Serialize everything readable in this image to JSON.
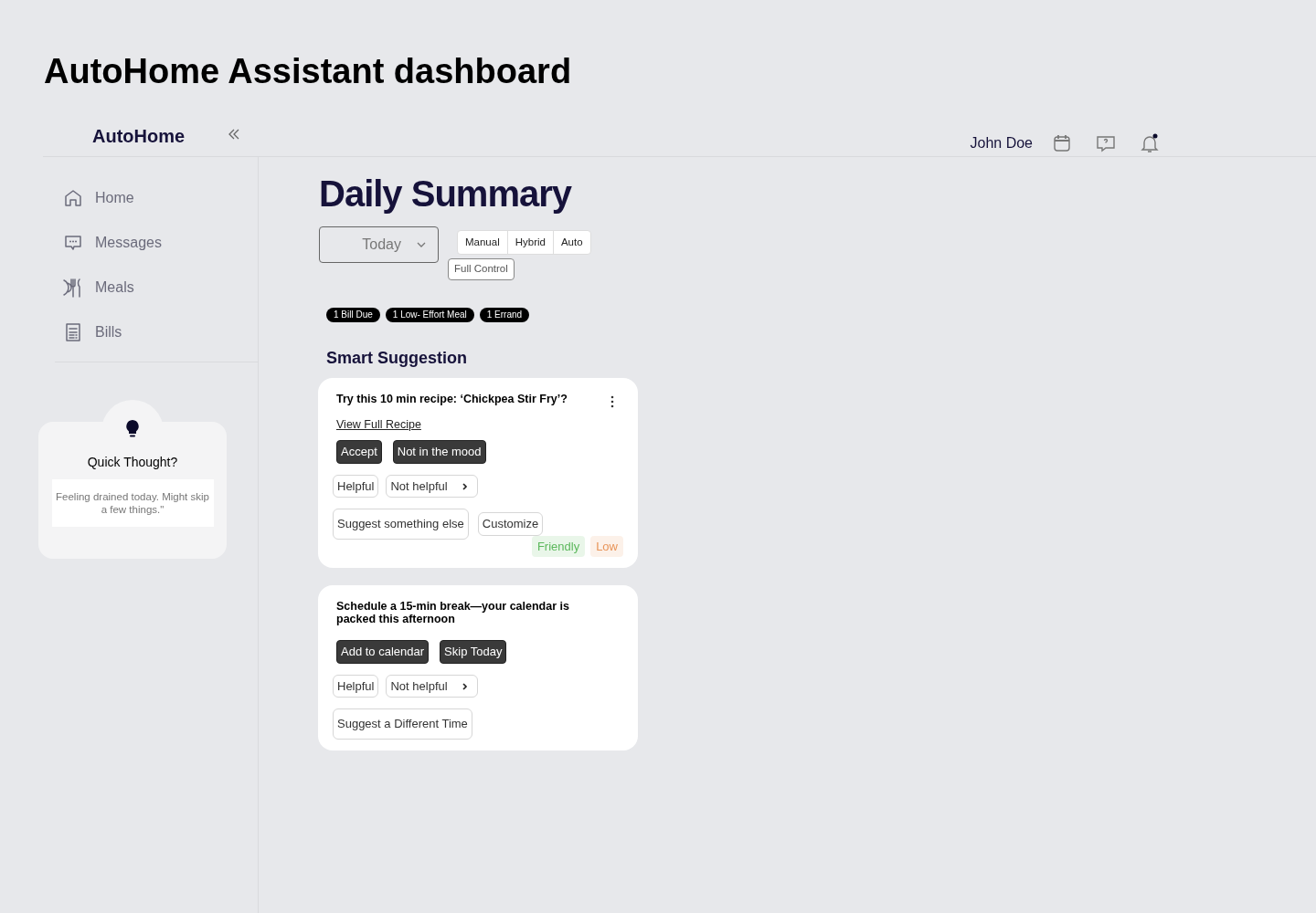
{
  "page_title": "AutoHome Assistant dashboard",
  "header": {
    "brand": "AutoHome",
    "user_name": "John Doe",
    "has_unread_notifications": true
  },
  "sidebar": {
    "items": [
      {
        "label": "Home",
        "kind": "home"
      },
      {
        "label": "Messages",
        "kind": "messages"
      },
      {
        "label": "Meals",
        "kind": "meals"
      },
      {
        "label": "Bills",
        "kind": "bills"
      }
    ],
    "quick_thought": {
      "title": "Quick Thought?",
      "text": "Feeling drained today. Might skip a few things.\""
    }
  },
  "main": {
    "title": "Daily Summary",
    "period_select": {
      "value": "Today"
    },
    "modes": [
      "Manual",
      "Hybrid",
      "Auto"
    ],
    "full_control": "Full Control",
    "chips": [
      "1 Bill Due",
      "1 Low- Effort Meal",
      "1 Errand"
    ],
    "section_title": "Smart Suggestion",
    "cards": [
      {
        "title": "Try this 10 min recipe: ‘Chickpea Stir Fry’?",
        "has_menu": true,
        "link": "View Full Recipe",
        "primary_actions": [
          "Accept",
          "Not in the mood"
        ],
        "feedback": [
          "Helpful",
          "Not helpful"
        ],
        "secondary_actions": [
          "Suggest something else",
          "Customize"
        ],
        "tags": [
          {
            "label": "Friendly",
            "color": "#5cb85c"
          },
          {
            "label": "Low",
            "color": "#e8955a"
          }
        ]
      },
      {
        "title": "Schedule a 15-min break—your calendar is packed this afternoon",
        "has_menu": false,
        "primary_actions": [
          "Add to calendar",
          "Skip Today"
        ],
        "feedback": [
          "Helpful",
          "Not helpful"
        ],
        "secondary_actions": [
          "Suggest a Different Time"
        ]
      }
    ]
  }
}
